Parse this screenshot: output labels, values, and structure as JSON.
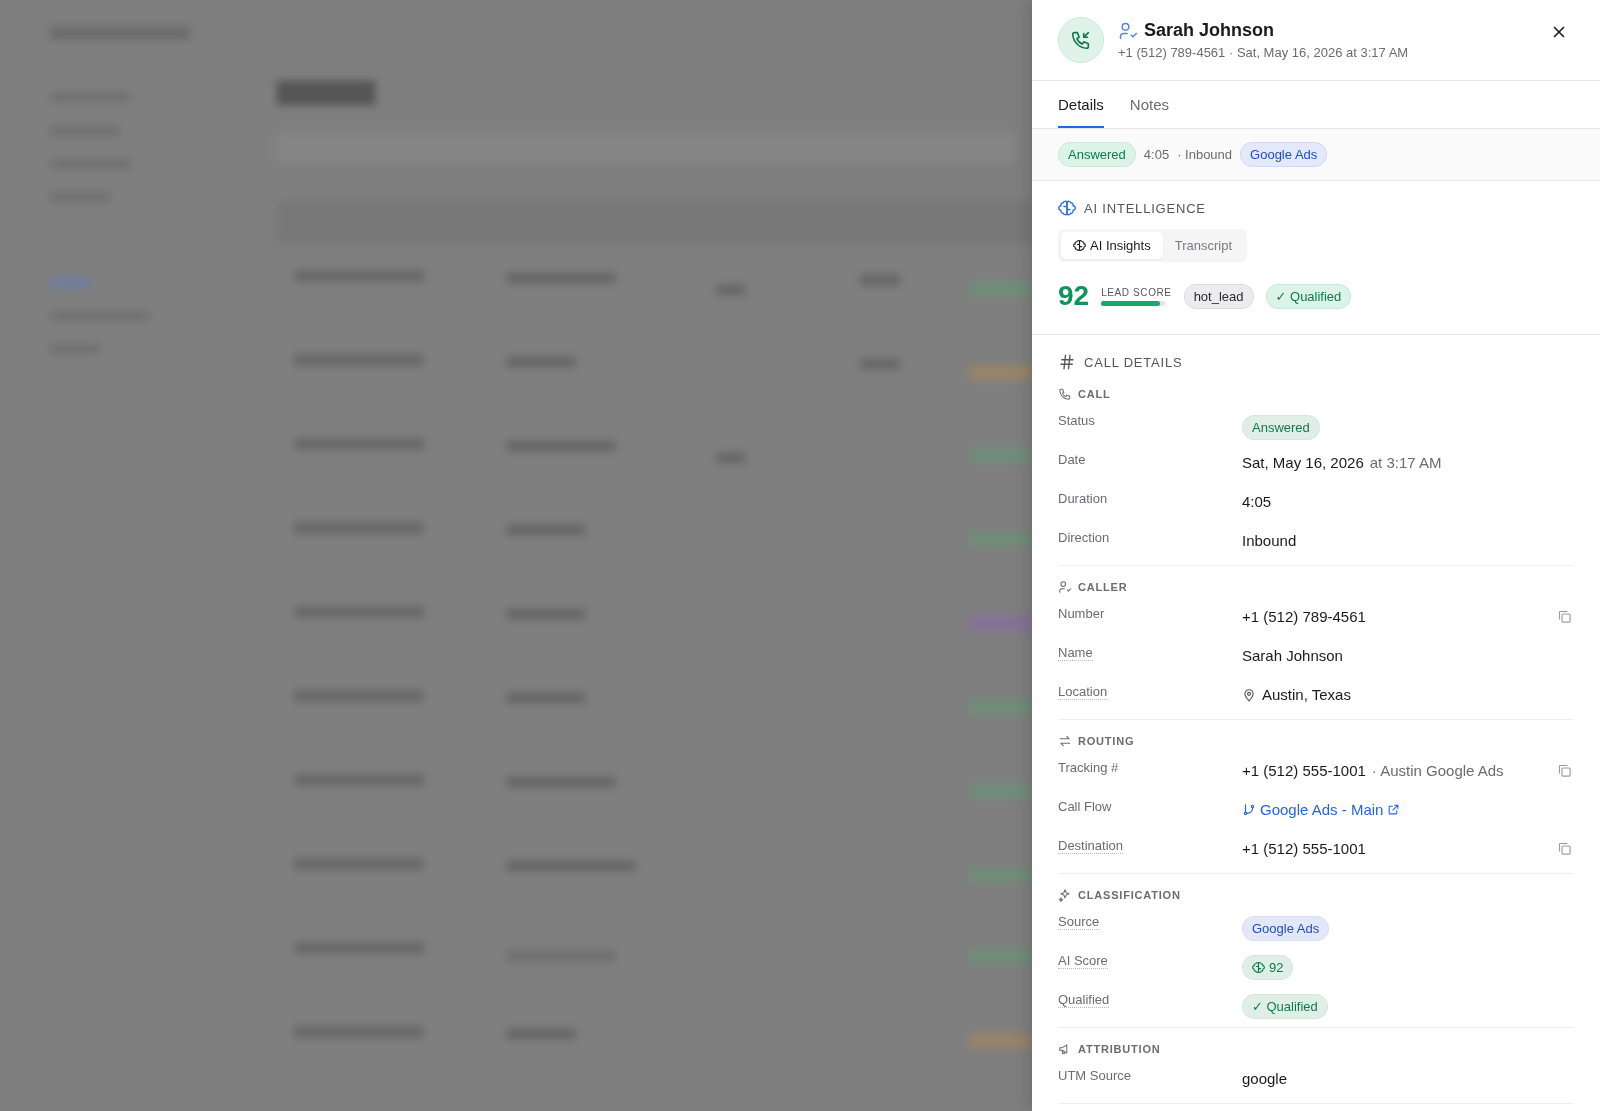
{
  "header": {
    "name": "Sarah Johnson",
    "subtitle": "+1 (512) 789-4561 · Sat, May 16, 2026 at 3:17 AM"
  },
  "tabs": [
    {
      "label": "Details",
      "selected": true
    },
    {
      "label": "Notes",
      "selected": false
    }
  ],
  "summary": [
    {
      "text": "Answered",
      "kind": "green"
    },
    {
      "text": "4:05",
      "kind": "plain"
    },
    {
      "text": "· Inbound",
      "kind": "plain"
    },
    {
      "text": "Google Ads",
      "kind": "blue"
    }
  ],
  "ai": {
    "title": "AI INTELLIGENCE",
    "subtabs": [
      {
        "label": "AI Insights",
        "selected": true
      },
      {
        "label": "Transcript",
        "selected": false
      }
    ],
    "score": "92",
    "score_label": "LEAD SCORE",
    "level": 0.92,
    "tags": [
      {
        "text": "hot_lead",
        "kind": "grey"
      },
      {
        "text": "✓ Qualified",
        "kind": "green"
      }
    ]
  },
  "details": {
    "title": "CALL DETAILS",
    "groups": [
      {
        "kind": "call",
        "title": "CALL",
        "rows": [
          {
            "label": "Status",
            "underlined": false,
            "copy": false,
            "kind": "badge",
            "value": "Answered",
            "color": "#0f7a4e"
          },
          {
            "label": "Date",
            "underlined": false,
            "copy": false,
            "kind": "text",
            "value": "Sat, May 16, 2026",
            "secondary": "at 3:17 AM"
          },
          {
            "label": "Duration",
            "underlined": false,
            "copy": false,
            "kind": "text",
            "value": "4:05"
          },
          {
            "label": "Direction",
            "underlined": false,
            "copy": false,
            "kind": "text",
            "value": "Inbound"
          }
        ]
      },
      {
        "kind": "caller",
        "title": "CALLER",
        "rows": [
          {
            "label": "Number",
            "underlined": false,
            "copy": true,
            "kind": "text",
            "value": "+1 (512) 789-4561"
          },
          {
            "label": "Name",
            "underlined": true,
            "copy": false,
            "kind": "text",
            "value": "Sarah Johnson"
          },
          {
            "label": "Location",
            "underlined": true,
            "copy": false,
            "kind": "location",
            "value": "Austin, Texas"
          }
        ]
      },
      {
        "kind": "routing",
        "title": "ROUTING",
        "rows": [
          {
            "label": "Tracking #",
            "underlined": false,
            "copy": true,
            "kind": "text",
            "value": "+1 (512) 555-1001",
            "secondary": "· Austin Google Ads"
          },
          {
            "label": "Call Flow",
            "underlined": false,
            "copy": false,
            "kind": "link",
            "value": "Google Ads - Main"
          },
          {
            "label": "Destination",
            "underlined": true,
            "copy": true,
            "kind": "text",
            "value": "+1 (512) 555-1001"
          }
        ]
      },
      {
        "kind": "classification",
        "title": "CLASSIFICATION",
        "rows": [
          {
            "label": "Source",
            "underlined": true,
            "copy": false,
            "kind": "badge",
            "value": "Google Ads",
            "color": "#1e4fc4"
          },
          {
            "label": "AI Score",
            "underlined": true,
            "copy": false,
            "kind": "score",
            "value": "92",
            "color": "#0f7a4e"
          },
          {
            "label": "Qualified",
            "underlined": true,
            "copy": false,
            "kind": "badge",
            "value": "✓ Qualified",
            "color": "#0f7a4e"
          }
        ]
      },
      {
        "kind": "attribution",
        "title": "ATTRIBUTION",
        "rows": [
          {
            "label": "UTM Source",
            "underlined": false,
            "copy": false,
            "kind": "text",
            "value": "google"
          }
        ]
      }
    ]
  }
}
